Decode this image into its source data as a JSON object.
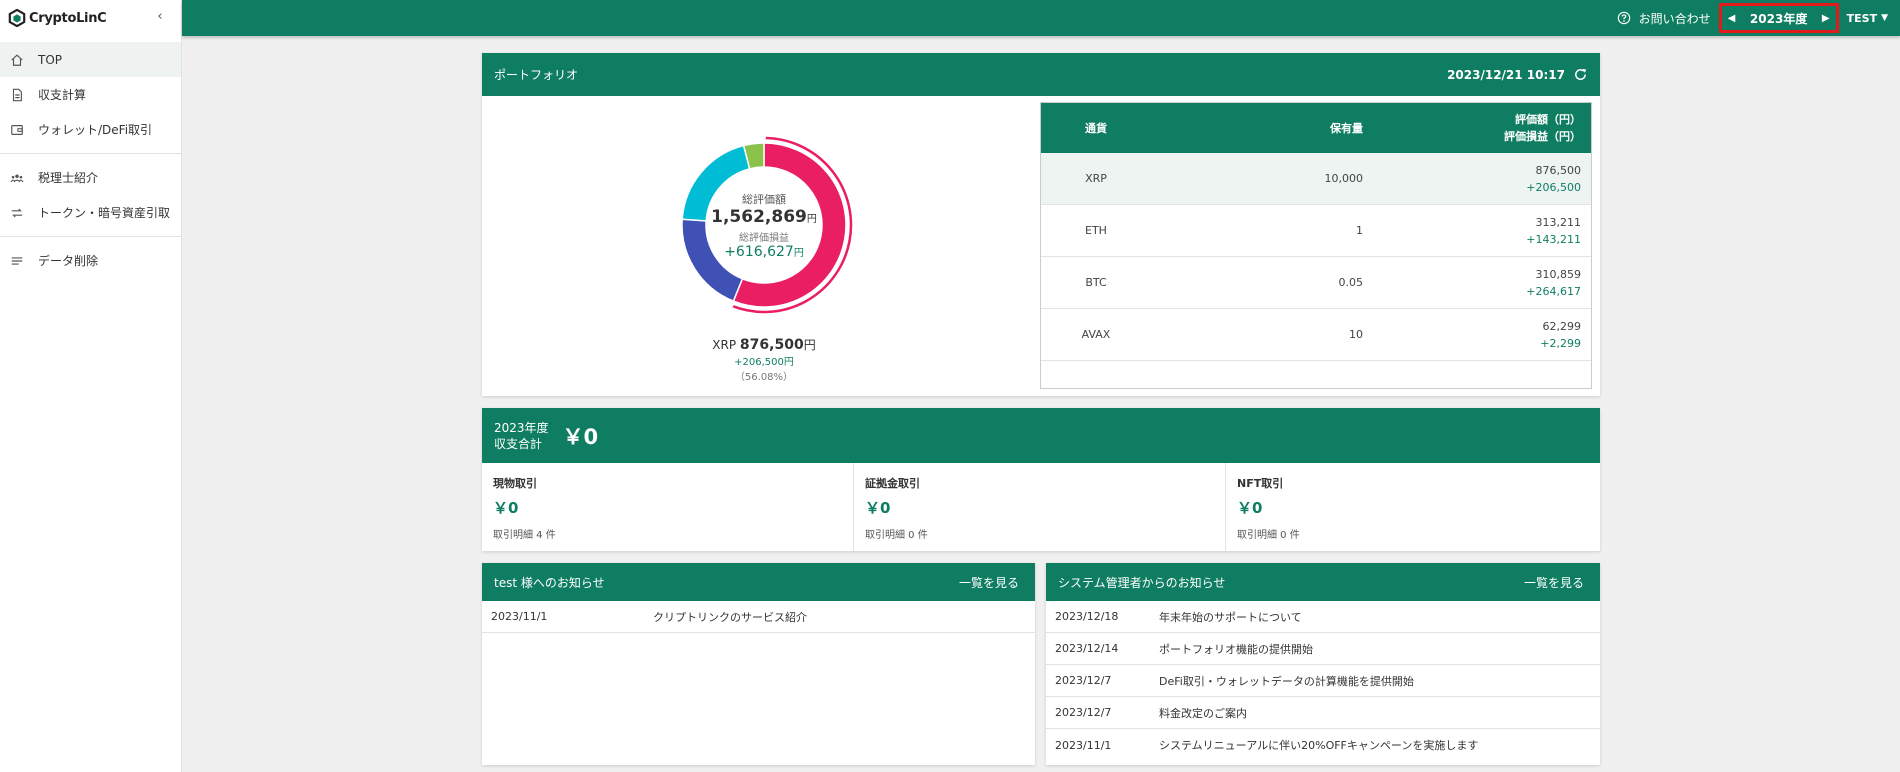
{
  "brand": {
    "name": "CryptoLinC"
  },
  "sidebar": {
    "group1": [
      {
        "label": "TOP",
        "icon": "home-icon"
      },
      {
        "label": "収支計算",
        "icon": "document-icon"
      },
      {
        "label": "ウォレット/DeFi取引",
        "icon": "wallet-icon"
      }
    ],
    "group2": [
      {
        "label": "税理士紹介",
        "icon": "people-icon"
      },
      {
        "label": "トークン・暗号資産引取",
        "icon": "swap-icon"
      }
    ],
    "group3": [
      {
        "label": "データ削除",
        "icon": "list-icon"
      }
    ]
  },
  "topbar": {
    "contact": "お問い合わせ",
    "year": "2023年度",
    "user": "TEST"
  },
  "portfolio": {
    "title": "ポートフォリオ",
    "timestamp": "2023/12/21 10:17",
    "center": {
      "total_label": "総評価額",
      "total": "1,562,869",
      "pnl_label": "総評価損益",
      "pnl": "+616,627",
      "unit": "円"
    },
    "caption": {
      "symbol": "XRP",
      "value": "876,500",
      "unit": "円",
      "pnl": "+206,500円",
      "pct": "（56.08%）"
    },
    "chart_data": {
      "type": "pie",
      "categories": [
        "XRP",
        "ETH",
        "BTC",
        "AVAX"
      ],
      "values": [
        876500,
        313211,
        310859,
        62299
      ],
      "colors": [
        "#e91e63",
        "#3f51b5",
        "#00bcd4",
        "#8bc34a"
      ]
    },
    "table": {
      "headers": {
        "currency": "通貨",
        "amount": "保有量",
        "value": "評価額（円）",
        "pnl": "評価損益（円）"
      },
      "rows": [
        {
          "currency": "XRP",
          "amount": "10,000",
          "value": "876,500",
          "pnl": "+206,500"
        },
        {
          "currency": "ETH",
          "amount": "1",
          "value": "313,211",
          "pnl": "+143,211"
        },
        {
          "currency": "BTC",
          "amount": "0.05",
          "value": "310,859",
          "pnl": "+264,617"
        },
        {
          "currency": "AVAX",
          "amount": "10",
          "value": "62,299",
          "pnl": "+2,299"
        }
      ]
    }
  },
  "summary": {
    "label_year": "2023年度",
    "label_text": "収支合計",
    "total": "￥0",
    "cols": [
      {
        "title": "現物取引",
        "amount": "￥0",
        "count": "取引明細 4 件"
      },
      {
        "title": "証拠金取引",
        "amount": "￥0",
        "count": "取引明細 0 件"
      },
      {
        "title": "NFT取引",
        "amount": "￥0",
        "count": "取引明細 0 件"
      }
    ]
  },
  "news_user": {
    "title": "test 様へのお知らせ",
    "see_all": "一覧を見る",
    "items": [
      {
        "date": "2023/11/1",
        "text": "クリプトリンクのサービス紹介"
      }
    ]
  },
  "news_system": {
    "title": "システム管理者からのお知らせ",
    "see_all": "一覧を見る",
    "items": [
      {
        "date": "2023/12/18",
        "text": "年末年始のサポートについて"
      },
      {
        "date": "2023/12/14",
        "text": "ポートフォリオ機能の提供開始"
      },
      {
        "date": "2023/12/7",
        "text": "DeFi取引・ウォレットデータの計算機能を提供開始"
      },
      {
        "date": "2023/12/7",
        "text": "料金改定のご案内"
      },
      {
        "date": "2023/11/1",
        "text": "システムリニューアルに伴い20%OFFキャンペーンを実施します"
      }
    ]
  }
}
